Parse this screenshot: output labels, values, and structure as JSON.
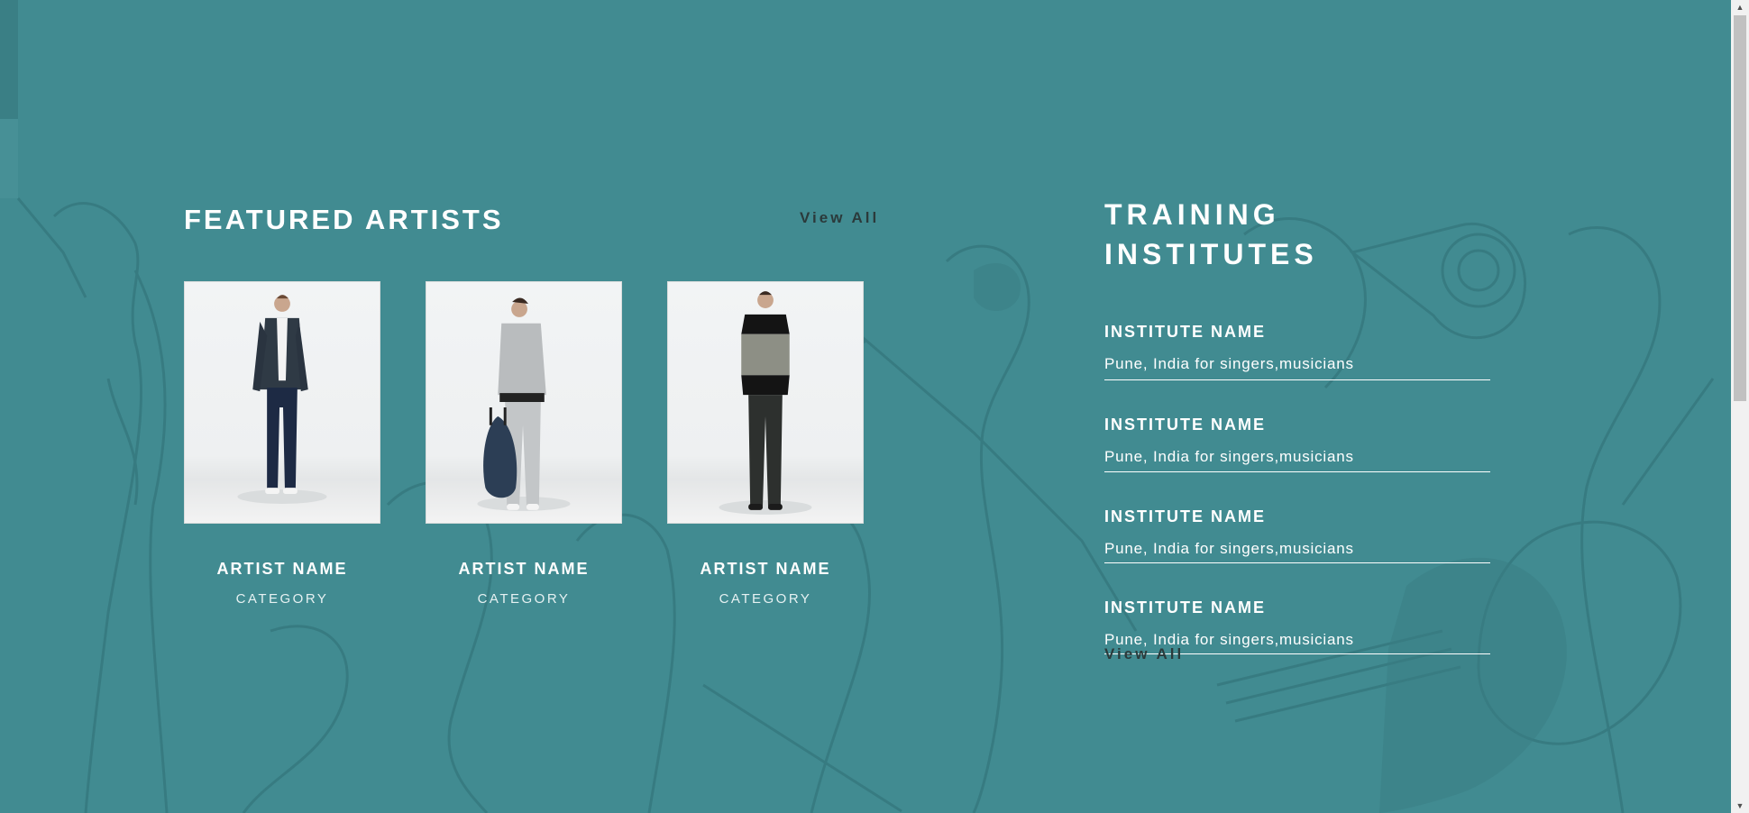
{
  "featured": {
    "title": "FEATURED ARTISTS",
    "view_all": "View All",
    "artists": [
      {
        "name": "ARTIST NAME",
        "category": "CATEGORY"
      },
      {
        "name": "ARTIST NAME",
        "category": "CATEGORY"
      },
      {
        "name": "ARTIST NAME",
        "category": "CATEGORY"
      }
    ]
  },
  "training": {
    "title": "TRAINING INSTITUTES",
    "view_all": "View All",
    "institutes": [
      {
        "name": "INSTITUTE NAME",
        "location": "Pune, India for singers,musicians"
      },
      {
        "name": "INSTITUTE NAME",
        "location": "Pune, India for singers,musicians"
      },
      {
        "name": "INSTITUTE NAME",
        "location": "Pune, India for singers,musicians"
      },
      {
        "name": "INSTITUTE NAME",
        "location": "Pune, India for singers,musicians"
      }
    ]
  },
  "colors": {
    "background": "#418b91",
    "title": "#ffffff",
    "view_all": "#2b3a3b"
  },
  "icons": [
    "scroll-up-arrow-icon",
    "scroll-down-arrow-icon"
  ]
}
